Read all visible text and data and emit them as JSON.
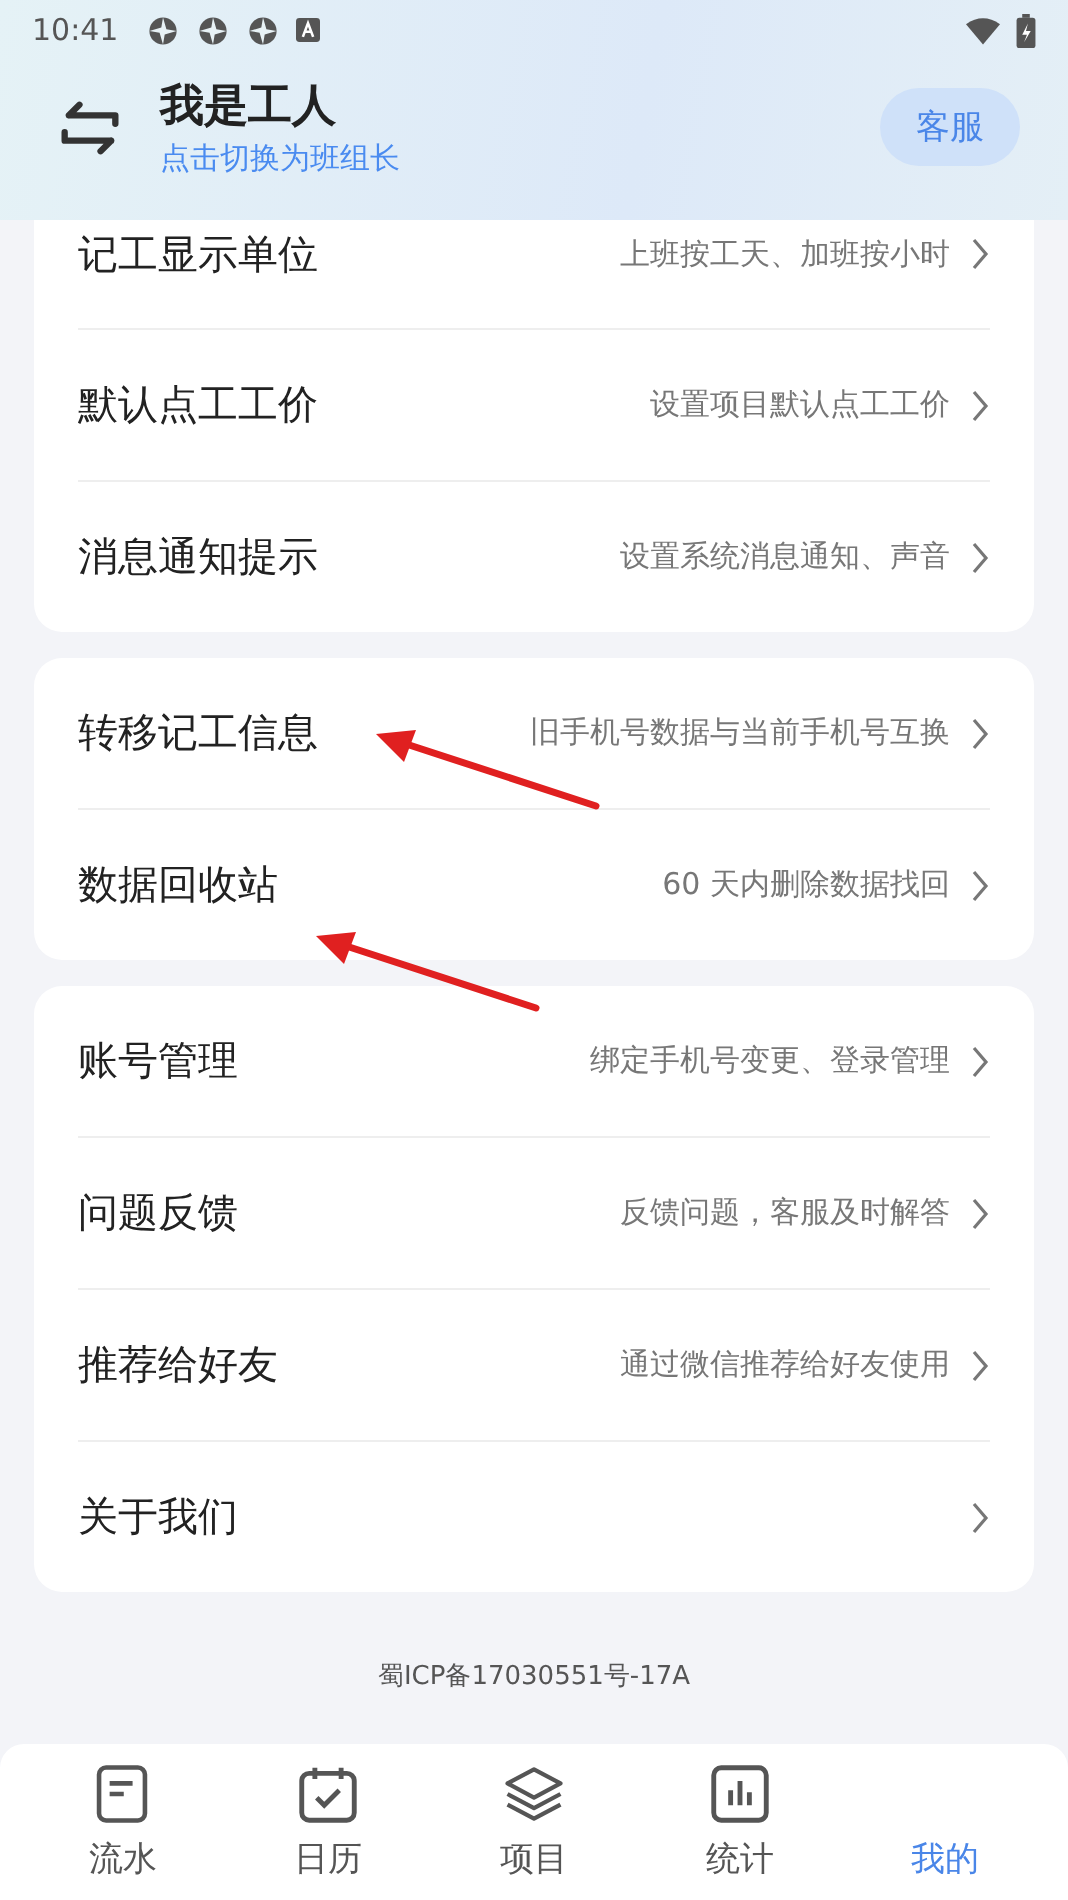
{
  "status_bar": {
    "time": "10:41"
  },
  "header": {
    "title": "我是工人",
    "subtitle": "点击切换为班组长",
    "service_button": "客服"
  },
  "groups": [
    {
      "rows": [
        {
          "label": "记工显示单位",
          "value": "上班按工天、加班按小时",
          "arrow_annotation": false
        },
        {
          "label": "默认点工工价",
          "value": "设置项目默认点工工价",
          "arrow_annotation": false
        },
        {
          "label": "消息通知提示",
          "value": "设置系统消息通知、声音",
          "arrow_annotation": false
        }
      ]
    },
    {
      "rows": [
        {
          "label": "转移记工信息",
          "value": "旧手机号数据与当前手机号互换",
          "arrow_annotation": true
        },
        {
          "label": "数据回收站",
          "value": "60 天内删除数据找回",
          "arrow_annotation": true
        }
      ]
    },
    {
      "rows": [
        {
          "label": "账号管理",
          "value": "绑定手机号变更、登录管理",
          "arrow_annotation": false
        },
        {
          "label": "问题反馈",
          "value": "反馈问题，客服及时解答",
          "arrow_annotation": false
        },
        {
          "label": "推荐给好友",
          "value": "通过微信推荐给好友使用",
          "arrow_annotation": false
        },
        {
          "label": "关于我们",
          "arrow_annotation": false
        }
      ]
    }
  ],
  "footer_text": "蜀ICP备17030551号-17A",
  "tabs": [
    {
      "label": "流水",
      "selected": false
    },
    {
      "label": "日历",
      "selected": false
    },
    {
      "label": "项目",
      "selected": false
    },
    {
      "label": "统计",
      "selected": false
    },
    {
      "label": "我的",
      "selected": true
    }
  ]
}
